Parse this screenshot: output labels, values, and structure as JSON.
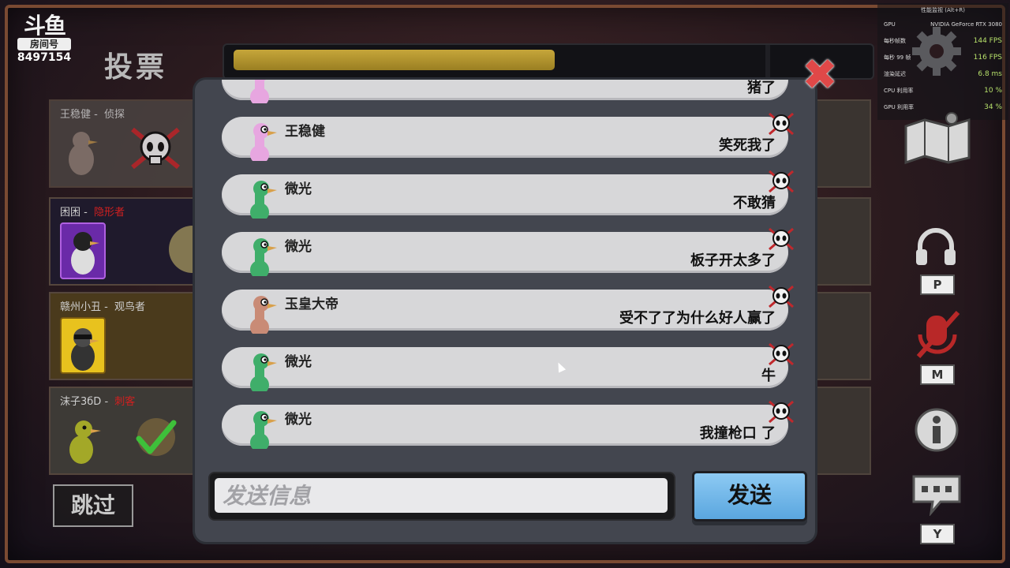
{
  "logo": {
    "brand": "斗鱼",
    "room_label": "房间号",
    "room_id": "8497154"
  },
  "screen_title": "投票",
  "vote_timer": {
    "progress": 0.51
  },
  "players": [
    {
      "name": "王稳健",
      "separator": " - ",
      "role": "侦探",
      "role_color": "#cfcfcf",
      "status_icon": "dead-skull-icon"
    },
    {
      "name": "困困",
      "separator": " - ",
      "role": "隐形者",
      "role_color": "#d02020",
      "status_icon": "none"
    },
    {
      "name": "赣州小丑",
      "separator": " - ",
      "role": "观鸟者",
      "role_color": "#cfcfcf",
      "status_icon": "none"
    },
    {
      "name": "沫子3бD",
      "separator": " - ",
      "role": "刺客",
      "role_color": "#d02020",
      "status_icon": "voted-check-icon"
    }
  ],
  "skip_label": "跳过",
  "chat": {
    "messages": [
      {
        "user": "",
        "text": "猪了",
        "avatar_color": "#e7a6e0"
      },
      {
        "user": "王稳健",
        "text": "笑死我了",
        "avatar_color": "#e7a6e0"
      },
      {
        "user": "微光",
        "text": "不敢猜",
        "avatar_color": "#3fae6a"
      },
      {
        "user": "微光",
        "text": "板子开太多了",
        "avatar_color": "#3fae6a"
      },
      {
        "user": "玉皇大帝",
        "text": "受不了了为什么好人赢了",
        "avatar_color": "#c98b76"
      },
      {
        "user": "微光",
        "text": "牛",
        "avatar_color": "#3fae6a"
      },
      {
        "user": "微光",
        "text": "我撞枪口 了",
        "avatar_color": "#3fae6a"
      }
    ],
    "input_placeholder": "发送信息",
    "send_label": "发送"
  },
  "side_keys": {
    "voice": "P",
    "mic": "M",
    "chat": "Y"
  },
  "perf_overlay": {
    "header": "性能监视 (Alt+R)",
    "rows": [
      {
        "label": "GPU",
        "value": "NVIDIA GeForce RTX 3080"
      },
      {
        "label": "每秒帧数",
        "value": "144 FPS"
      },
      {
        "label": "每秒 99 帧",
        "value": "116 FPS"
      },
      {
        "label": "渲染延迟",
        "value": "6.8 ms"
      },
      {
        "label": "CPU 利用率",
        "value": "10 %"
      },
      {
        "label": "GPU 利用率",
        "value": "34 %"
      }
    ]
  },
  "colors": {
    "accent_gold": "#c6a63a",
    "send_blue": "#5aa6df",
    "close_red": "#e04848"
  }
}
